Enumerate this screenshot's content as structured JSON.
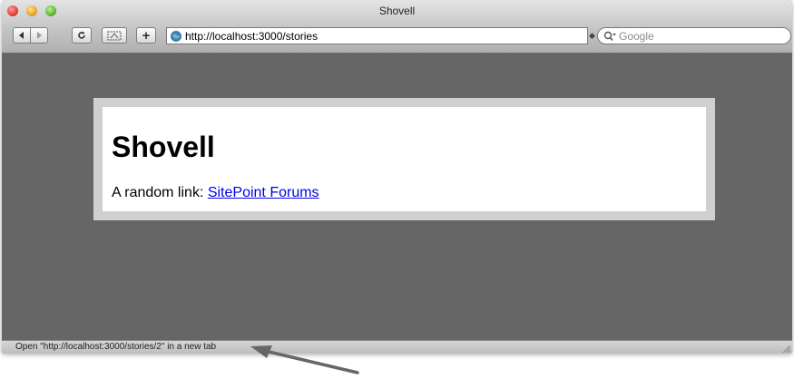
{
  "window": {
    "title": "Shovell"
  },
  "toolbar": {
    "back_icon": "back-arrow-icon",
    "forward_icon": "forward-arrow-icon",
    "reload_label": "C",
    "add_label": "+",
    "address_value": "http://localhost:3000/stories",
    "search_placeholder": "Google"
  },
  "page": {
    "heading": "Shovell",
    "random_prefix": "A random link: ",
    "link_text": "SitePoint Forums"
  },
  "status": {
    "text": "Open \"http://localhost:3000/stories/2\" in a new tab"
  },
  "colors": {
    "page_background": "#666666",
    "card_border": "#d0d0d0",
    "link": "#0000ee"
  }
}
